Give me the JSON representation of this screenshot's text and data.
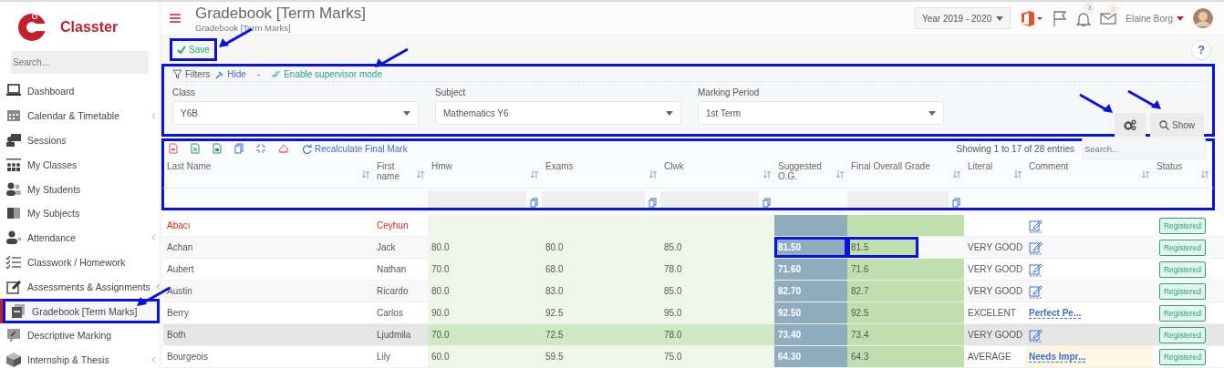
{
  "brand": {
    "name": "Classter"
  },
  "sidebar": {
    "search_placeholder": "Search...",
    "items": [
      {
        "label": "Dashboard",
        "expandable": false,
        "selected": false
      },
      {
        "label": "Calendar & Timetable",
        "expandable": true,
        "selected": false
      },
      {
        "label": "Sessions",
        "expandable": false,
        "selected": false
      },
      {
        "label": "My Classes",
        "expandable": false,
        "selected": false
      },
      {
        "label": "My Students",
        "expandable": false,
        "selected": false
      },
      {
        "label": "My Subjects",
        "expandable": false,
        "selected": false
      },
      {
        "label": "Attendance",
        "expandable": true,
        "selected": false
      },
      {
        "label": "Classwork / Homework",
        "expandable": false,
        "selected": false
      },
      {
        "label": "Assessments & Assignments",
        "expandable": true,
        "selected": false
      },
      {
        "label": "Gradebook [Term Marks]",
        "expandable": false,
        "selected": true,
        "highlighted": true,
        "arrow": true
      },
      {
        "label": "Descriptive Marking",
        "expandable": false,
        "selected": false
      },
      {
        "label": "Internship & Thesis",
        "expandable": true,
        "selected": false
      }
    ]
  },
  "header": {
    "title": "Gradebook [Term Marks]",
    "subtitle": "Gradebook [Term Marks]",
    "year": "Year 2019 - 2020",
    "notifications": "3",
    "messages": "0",
    "user": "Elaine Borg"
  },
  "save_button": {
    "label": "Save",
    "highlighted": true,
    "arrow": true
  },
  "help_button": {
    "label": "?"
  },
  "filters": {
    "highlighted": true,
    "label": "Filters",
    "hide": "Hide",
    "separator": "-",
    "supervisor": "Enable supervisor mode",
    "supervisor_arrow": true,
    "fields": [
      {
        "label": "Class",
        "value": "Y6B"
      },
      {
        "label": "Subject",
        "value": "Mathematics Y6"
      },
      {
        "label": "Marking Period",
        "value": "1st Term"
      }
    ],
    "settings_arrow": true,
    "show_button": {
      "label": "Show",
      "arrow": true
    }
  },
  "table": {
    "highlighted": true,
    "recalculate": "Recalculate Final Mark",
    "info": "Showing 1 to 17 of 28 entries",
    "search_placeholder": "Search...",
    "columns": [
      {
        "label": "Last Name",
        "filter": false
      },
      {
        "label": "First name",
        "filter": false
      },
      {
        "label": "Hmw",
        "filter": true
      },
      {
        "label": "Exams",
        "filter": true
      },
      {
        "label": "Clwk",
        "filter": true
      },
      {
        "label": "Suggested O.G.",
        "filter": false
      },
      {
        "label": "Final Overall Grade",
        "filter": true
      },
      {
        "label": "Literal",
        "filter": false
      },
      {
        "label": "Comment",
        "filter": false
      },
      {
        "label": "Status",
        "filter": false
      }
    ],
    "rows": [
      {
        "last": "Abacı",
        "first": "Ceyhun",
        "comment": {
          "kind": "icon"
        },
        "status": "Registered",
        "flagged": true,
        "selected": false
      },
      {
        "last": "Achan",
        "first": "Jack",
        "hmw": "80.0",
        "exams": "80.0",
        "clwk": "85.0",
        "suggested": "81.50",
        "final": "81.5",
        "literal": "VERY GOOD",
        "comment": {
          "kind": "icon"
        },
        "status": "Registered",
        "flagged": false,
        "selected": false,
        "highlighted": true
      },
      {
        "last": "Aubert",
        "first": "Nathan",
        "hmw": "70.0",
        "exams": "68.0",
        "clwk": "78.0",
        "suggested": "71.60",
        "final": "71.6",
        "literal": "VERY GOOD",
        "comment": {
          "kind": "icon"
        },
        "status": "Registered",
        "flagged": false,
        "selected": false
      },
      {
        "last": "Austin",
        "first": "Ricardo",
        "hmw": "80.0",
        "exams": "83.0",
        "clwk": "85.0",
        "suggested": "82.70",
        "final": "82.7",
        "literal": "VERY GOOD",
        "comment": {
          "kind": "icon"
        },
        "status": "Registered",
        "flagged": false,
        "selected": false
      },
      {
        "last": "Berry",
        "first": "Carlos",
        "hmw": "90.0",
        "exams": "92.5",
        "clwk": "95.0",
        "suggested": "92.50",
        "final": "92.5",
        "literal": "EXCELENT",
        "comment": {
          "kind": "text",
          "text": "Perfect Pe...",
          "tinted": false
        },
        "status": "Registered",
        "flagged": false,
        "selected": false
      },
      {
        "last": "Both",
        "first": "Ljudmila",
        "hmw": "70.0",
        "exams": "72.5",
        "clwk": "78.0",
        "suggested": "73.40",
        "final": "73.4",
        "literal": "VERY GOOD",
        "comment": {
          "kind": "icon"
        },
        "status": "Registered",
        "flagged": false,
        "selected": true
      },
      {
        "last": "Bourgeois",
        "first": "Lily",
        "hmw": "60.0",
        "exams": "59.5",
        "clwk": "75.0",
        "suggested": "64.30",
        "final": "64.3",
        "literal": "AVERAGE",
        "comment": {
          "kind": "text",
          "text": "Needs Impr...",
          "tinted": true
        },
        "status": "Registered",
        "flagged": false,
        "selected": false
      }
    ]
  }
}
